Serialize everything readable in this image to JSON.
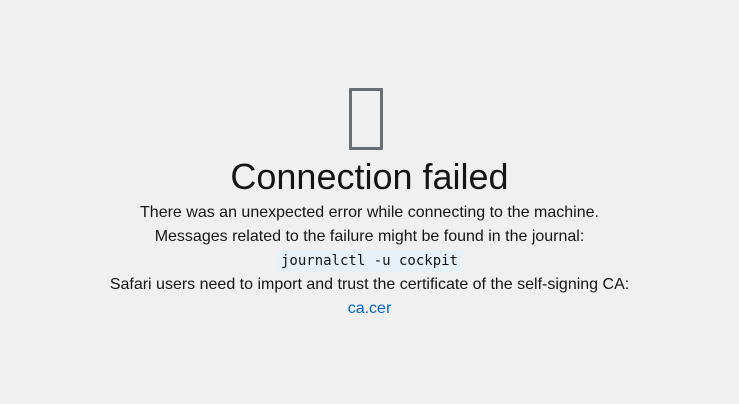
{
  "error": {
    "icon": "missing-glyph-icon",
    "title": "Connection failed",
    "message": "There was an unexpected error while connecting to the machine.",
    "journal_hint": "Messages related to the failure might be found in the journal:",
    "journal_command": "journalctl -u cockpit",
    "safari_hint": "Safari users need to import and trust the certificate of the self-signing CA:",
    "ca_link": "ca.cer"
  },
  "colors": {
    "background": "#f0f0f0",
    "text": "#151515",
    "icon": "#6a6e73",
    "link": "#0066cc",
    "code_background": "#e7f1fa"
  }
}
